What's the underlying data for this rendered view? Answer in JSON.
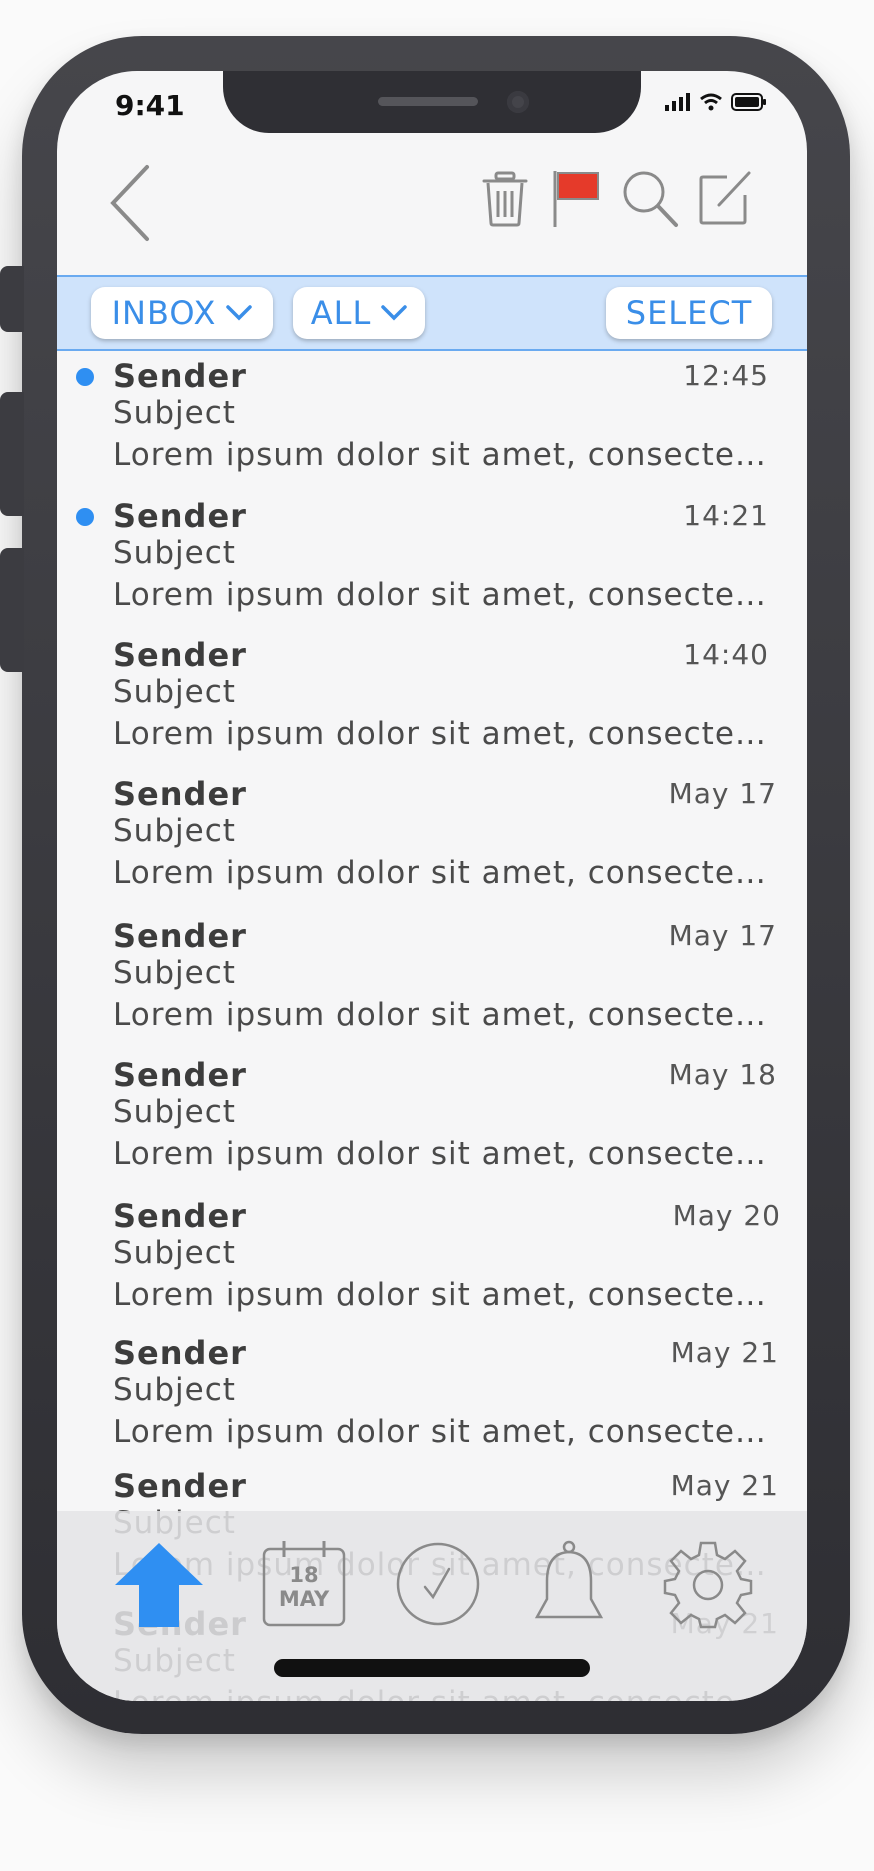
{
  "status_bar": {
    "time": "9:41"
  },
  "filter_bar": {
    "inbox_label": "INBOX",
    "all_label": "ALL",
    "select_label": "SELECT"
  },
  "emails": [
    {
      "sender": "Sender",
      "subject": "Subject",
      "preview": "Lorem ipsum dolor sit amet, consectetur",
      "time": "12:45",
      "unread": true
    },
    {
      "sender": "Sender",
      "subject": "Subject",
      "preview": "Lorem ipsum dolor sit amet, consectetur",
      "time": "14:21",
      "unread": true
    },
    {
      "sender": "Sender",
      "subject": "Subject",
      "preview": "Lorem ipsum dolor sit amet, consectetur",
      "time": "14:40",
      "unread": false
    },
    {
      "sender": "Sender",
      "subject": "Subject",
      "preview": "Lorem ipsum dolor sit amet, consectetur",
      "time": "May 17",
      "unread": false
    },
    {
      "sender": "Sender",
      "subject": "Subject",
      "preview": "Lorem ipsum dolor sit amet, consectetur",
      "time": "May 17",
      "unread": false
    },
    {
      "sender": "Sender",
      "subject": "Subject",
      "preview": "Lorem ipsum dolor sit amet, consectetur",
      "time": "May 18",
      "unread": false
    },
    {
      "sender": "Sender",
      "subject": "Subject",
      "preview": "Lorem ipsum dolor sit amet, consectetur",
      "time": "May 20",
      "unread": false
    },
    {
      "sender": "Sender",
      "subject": "Subject",
      "preview": "Lorem ipsum dolor sit amet, consectetur",
      "time": "May 21",
      "unread": false
    },
    {
      "sender": "Sender",
      "subject": "Subject",
      "preview": "Lorem ipsum dolor sit amet, consectetur",
      "time": "May 21",
      "unread": false
    },
    {
      "sender": "Sender",
      "subject": "Subject",
      "preview": "Lorem ipsum dolor sit amet, consectetur",
      "time": "May 21",
      "unread": false
    }
  ],
  "tab_bar": {
    "calendar_day": "18",
    "calendar_month": "MAY",
    "items": [
      "home-icon",
      "calendar-icon",
      "check-icon",
      "bell-icon",
      "gear-icon"
    ]
  },
  "colors": {
    "accent": "#3a8ee8",
    "unread_dot": "#2f8ff2",
    "flag": "#e53a2a",
    "filter_bar_bg": "#cfe3fb"
  }
}
